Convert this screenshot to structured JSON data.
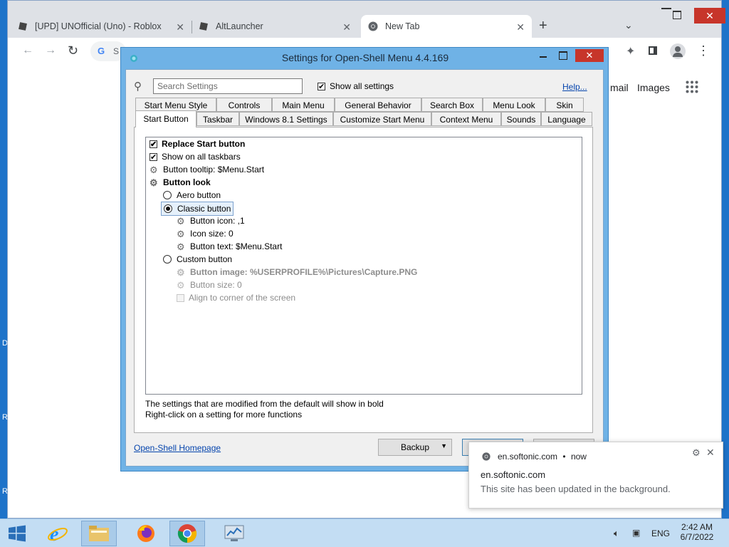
{
  "browser": {
    "tabs": [
      {
        "title": "[UPD] UNOfficial (Uno) - Roblox",
        "icon": "roblox-icon"
      },
      {
        "title": "AltLauncher",
        "icon": "roblox-icon"
      },
      {
        "title": "New Tab",
        "icon": "chrome-icon"
      }
    ],
    "omnibox_partial": "S",
    "page_links": [
      "mail",
      "Images"
    ]
  },
  "dialog": {
    "title": "Settings for Open-Shell Menu 4.4.169",
    "search_placeholder": "Search Settings",
    "show_all_label": "Show all settings",
    "help_link": "Help...",
    "tabs_row1": [
      "Start Menu Style",
      "Controls",
      "Main Menu",
      "General Behavior",
      "Search Box",
      "Menu Look",
      "Skin"
    ],
    "tabs_row2": [
      "Start Button",
      "Taskbar",
      "Windows 8.1 Settings",
      "Customize Start Menu",
      "Context Menu",
      "Sounds",
      "Language"
    ],
    "active_tab": "Start Button",
    "settings": [
      {
        "label": "Replace Start button",
        "kind": "check",
        "checked": true,
        "bold": true
      },
      {
        "label": "Show on all taskbars",
        "kind": "check",
        "checked": true
      },
      {
        "label": "Button tooltip: $Menu.Start",
        "kind": "gear"
      },
      {
        "label": "Button look",
        "kind": "gear",
        "bold": true
      },
      {
        "label": "Aero button",
        "kind": "radio"
      },
      {
        "label": "Classic button",
        "kind": "radio",
        "selected": true
      },
      {
        "label": "Button icon: ,1",
        "kind": "gear"
      },
      {
        "label": "Icon size: 0",
        "kind": "gear"
      },
      {
        "label": "Button text: $Menu.Start",
        "kind": "gear"
      },
      {
        "label": "Custom button",
        "kind": "radio"
      },
      {
        "label": "Button image: %USERPROFILE%\\Pictures\\Capture.PNG",
        "kind": "gear",
        "bold": true,
        "disabled": true
      },
      {
        "label": "Button size: 0",
        "kind": "gear",
        "disabled": true
      },
      {
        "label": "Align to corner of the screen",
        "kind": "check",
        "disabled": true
      }
    ],
    "hint_line1": "The settings that are modified from the default will show in bold",
    "hint_line2": "Right-click on a setting for more functions",
    "homepage_link": "Open-Shell Homepage",
    "backup_label": "Backup"
  },
  "notification": {
    "source": "en.softonic.com",
    "time": "now",
    "title": "en.softonic.com",
    "body": "This site has been updated in the background."
  },
  "taskbar": {
    "lang": "ENG",
    "time": "2:42 AM",
    "date": "6/7/2022"
  },
  "desktop_edge_letters": [
    "D",
    "R",
    "R"
  ]
}
